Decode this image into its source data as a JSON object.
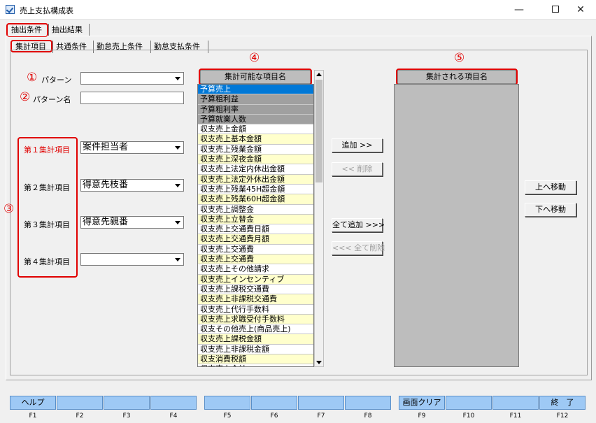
{
  "window": {
    "title": "売上支払構成表",
    "min_glyph": "—",
    "close_glyph": "✕"
  },
  "main_tabs": [
    {
      "label": "抽出条件",
      "selected": true
    },
    {
      "label": "抽出結果",
      "selected": false
    }
  ],
  "sub_tabs": [
    {
      "label": "集計項目",
      "selected": true
    },
    {
      "label": "共通条件",
      "selected": false
    },
    {
      "label": "勤怠売上条件",
      "selected": false
    },
    {
      "label": "勤怠支払条件",
      "selected": false
    }
  ],
  "annotations": {
    "n1": "①",
    "n2": "②",
    "n3": "③",
    "n4": "④",
    "n5": "⑤"
  },
  "form": {
    "pattern_label": "パターン",
    "pattern_value": "",
    "pattern_name_label": "パターン名",
    "pattern_name_value": "",
    "items": [
      {
        "label": "第１集計項目",
        "value": "案件担当者",
        "highlight": true
      },
      {
        "label": "第２集計項目",
        "value": "得意先枝番",
        "highlight": false
      },
      {
        "label": "第３集計項目",
        "value": "得意先親番",
        "highlight": false
      },
      {
        "label": "第４集計項目",
        "value": "",
        "highlight": false
      }
    ]
  },
  "available_list": {
    "header": "集計可能な項目名",
    "items": [
      {
        "label": "予算売上",
        "style": "sel"
      },
      {
        "label": "予算粗利益",
        "style": "gray"
      },
      {
        "label": "予算粗利率",
        "style": "gray"
      },
      {
        "label": "予算就業人数",
        "style": "gray"
      },
      {
        "label": "収支売上金額",
        "style": "white"
      },
      {
        "label": "収支売上基本金額",
        "style": "yellow"
      },
      {
        "label": "収支売上残業金額",
        "style": "white"
      },
      {
        "label": "収支売上深夜金額",
        "style": "yellow"
      },
      {
        "label": "収支売上法定内休出金額",
        "style": "white"
      },
      {
        "label": "収支売上法定外休出金額",
        "style": "yellow"
      },
      {
        "label": "収支売上残業45H超金額",
        "style": "white"
      },
      {
        "label": "収支売上残業60H超金額",
        "style": "yellow"
      },
      {
        "label": "収支売上調整金",
        "style": "white"
      },
      {
        "label": "収支売上立替金",
        "style": "yellow"
      },
      {
        "label": "収支売上交通費日額",
        "style": "white"
      },
      {
        "label": "収支売上交通費月額",
        "style": "yellow"
      },
      {
        "label": "収支売上交通費",
        "style": "white"
      },
      {
        "label": "収支売上交通費",
        "style": "yellow"
      },
      {
        "label": "収支売上その他請求",
        "style": "white"
      },
      {
        "label": "収支売上インセンティブ",
        "style": "yellow"
      },
      {
        "label": "収支売上課税交通費",
        "style": "white"
      },
      {
        "label": "収支売上非課税交通費",
        "style": "yellow"
      },
      {
        "label": "収支売上代行手数料",
        "style": "white"
      },
      {
        "label": "収支売上求職受付手数料",
        "style": "yellow"
      },
      {
        "label": "収支その他売上(商品売上)",
        "style": "white"
      },
      {
        "label": "収支売上課税金額",
        "style": "yellow"
      },
      {
        "label": "収支売上非課税金額",
        "style": "white"
      },
      {
        "label": "収支消費税額",
        "style": "yellow"
      },
      {
        "label": "収支売上合計",
        "style": "white"
      }
    ]
  },
  "target_list": {
    "header": "集計される項目名"
  },
  "buttons": {
    "add": "追加 >>",
    "remove": "<< 削除",
    "add_all": "全て追加 >>>",
    "remove_all": "<<< 全て削除",
    "move_up": "上へ移動",
    "move_down": "下へ移動"
  },
  "function_keys": [
    {
      "key": "F1",
      "label": "ヘルプ"
    },
    {
      "key": "F2",
      "label": ""
    },
    {
      "key": "F3",
      "label": ""
    },
    {
      "key": "F4",
      "label": ""
    },
    {
      "key": "F5",
      "label": ""
    },
    {
      "key": "F6",
      "label": ""
    },
    {
      "key": "F7",
      "label": ""
    },
    {
      "key": "F8",
      "label": ""
    },
    {
      "key": "F9",
      "label": "画面クリア"
    },
    {
      "key": "F10",
      "label": ""
    },
    {
      "key": "F11",
      "label": ""
    },
    {
      "key": "F12",
      "label": "終　了"
    }
  ],
  "colors": {
    "annotation_red": "#e00000",
    "selection_blue": "#0078d7",
    "fkey_blue": "#9ec9f5",
    "list_yellow": "#ffffcc",
    "list_gray": "#a0a0a0"
  }
}
